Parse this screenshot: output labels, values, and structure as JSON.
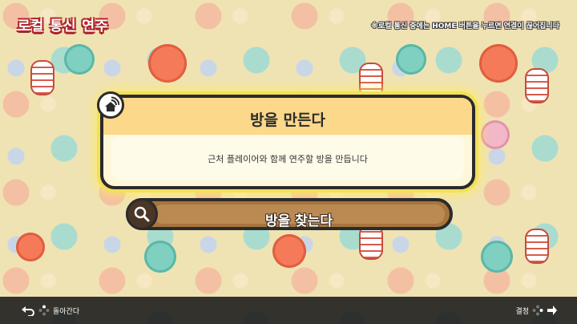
{
  "header": {
    "mode_title": "로컬 통신 연주",
    "notice": "※로컬 통신 중에는 HOME 버튼을 누르면 연결이 끊어집니다"
  },
  "create_room": {
    "title": "방을 만든다",
    "description": "근처 플레이어와 함께 연주할 방을 만듭니다",
    "icon": "wireless-house-icon",
    "highlight_color": "#f2e05a"
  },
  "find_room": {
    "label": "방을 찾는다",
    "icon": "search-icon"
  },
  "footer": {
    "back_label": "돌아간다",
    "confirm_label": "결정"
  }
}
